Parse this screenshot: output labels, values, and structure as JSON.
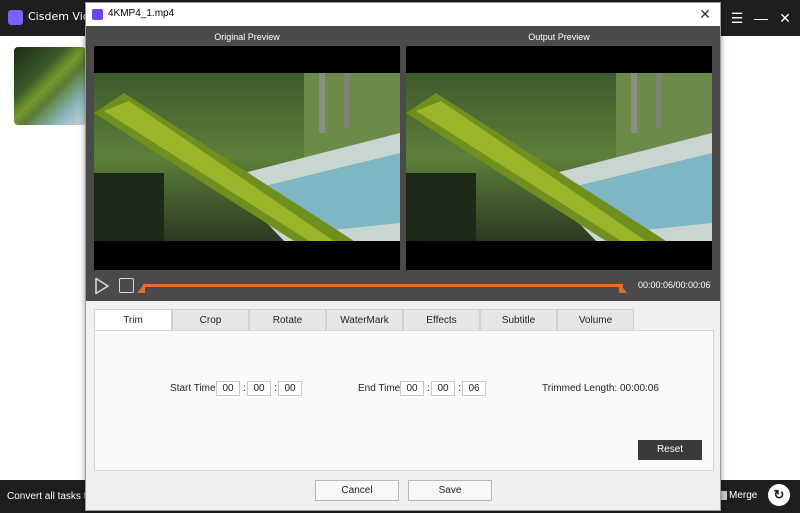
{
  "app": {
    "title": "Cisdem Video",
    "footer_text": "Convert all tasks to",
    "merge_label": "Merge"
  },
  "dialog": {
    "title": "4KMP4_1.mp4",
    "original_preview_label": "Original Preview",
    "output_preview_label": "Output Preview",
    "time_readout": "00:00:06/00:00:06",
    "tabs": [
      {
        "label": "Trim",
        "active": true
      },
      {
        "label": "Crop",
        "active": false
      },
      {
        "label": "Rotate",
        "active": false
      },
      {
        "label": "WaterMark",
        "active": false
      },
      {
        "label": "Effects",
        "active": false
      },
      {
        "label": "Subtitle",
        "active": false
      },
      {
        "label": "Volume",
        "active": false
      }
    ],
    "trim": {
      "start_label": "Start Time:",
      "start": {
        "h": "00",
        "m": "00",
        "s": "00"
      },
      "end_label": "End Time:",
      "end": {
        "h": "00",
        "m": "00",
        "s": "06"
      },
      "trimmed_length": "Trimmed Length: 00:00:06",
      "reset_label": "Reset"
    },
    "cancel_label": "Cancel",
    "save_label": "Save"
  },
  "colors": {
    "accent": "#e0712d",
    "titlebar": "#1e1e1e",
    "preview_bg": "#4a4a4a"
  }
}
